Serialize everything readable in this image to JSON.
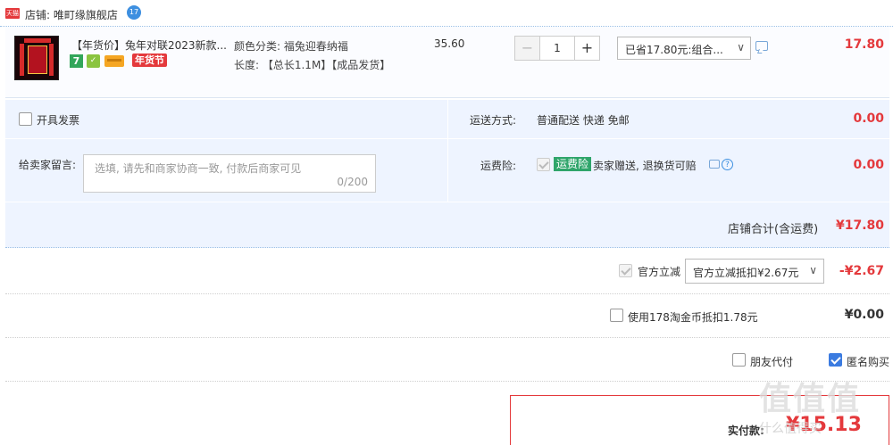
{
  "shop": {
    "badge": "天猫",
    "label": "店铺: 唯町缘旗舰店",
    "ww_badge": "17"
  },
  "item": {
    "title": "【年货价】兔年对联2023新款...",
    "badge_7": "7",
    "badge_festival": "年货节",
    "sku_color": "颜色分类: 福兔迎春纳福",
    "sku_length": "长度: 【总长1.1M】【成品发货】",
    "unit_price": "35.60",
    "quantity": "1",
    "qty_minus": "−",
    "qty_plus": "+",
    "promo": "已省17.80元:组合...",
    "total": "17.80"
  },
  "invoice": {
    "label": "开具发票"
  },
  "shipping": {
    "label": "运送方式:",
    "value": "普通配送 快递 免邮",
    "price": "0.00"
  },
  "memo": {
    "label": "给卖家留言:",
    "placeholder": "选填, 请先和商家协商一致, 付款后商家可见",
    "count": "0/200"
  },
  "insurance": {
    "label": "运费险:",
    "tag": "运费险",
    "text": "卖家赠送, 退换货可赔",
    "price": "0.00"
  },
  "shop_total": {
    "label": "店铺合计(含运费)",
    "amount": "¥17.80"
  },
  "official_discount": {
    "label": "官方立减",
    "select": "官方立减抵扣¥2.67元",
    "amount": "-¥2.67"
  },
  "taojinbi": {
    "label": "使用178淘金币抵扣1.78元",
    "amount": "¥0.00"
  },
  "options": {
    "friend_pay": "朋友代付",
    "anonymous": "匿名购买"
  },
  "total": {
    "label": "实付款:",
    "amount": "¥15.13"
  },
  "watermark": {
    "text": "值值值",
    "site": "什么值得买"
  },
  "colors": {
    "accent": "#e4393c",
    "block_bg": "#eef4ff",
    "checkbox_blue": "#3b7be0"
  }
}
